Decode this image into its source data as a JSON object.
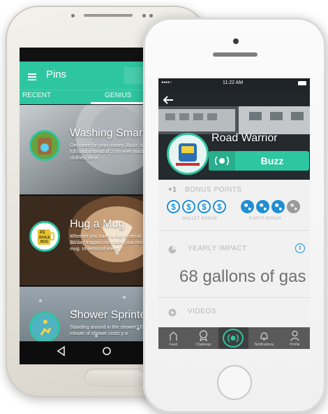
{
  "android": {
    "header_title": "Pins",
    "tabs": [
      "RECENT",
      "GENIUS"
    ],
    "cards": [
      {
        "title": "Washing Smart",
        "desc": "Get more for your money. Buzz. wash 1 full load instead of 2 sm ever wash clean clothes, be a"
      },
      {
        "title": "Hug a Mug",
        "desc": "Whether you have a cup o' decaf an $8/day frappuccino habit, you reusable mug. In terms of energ",
        "badge_top": "#1",
        "badge_mid": "JOULE",
        "badge_bottom": "BUG"
      },
      {
        "title": "Shower Sprinter",
        "desc": "Standing around in the shower? Every minute of shower costs y a"
      }
    ],
    "nav_icons": [
      "back-triangle",
      "home-circle"
    ]
  },
  "iphone": {
    "status": {
      "signal": "●●●●○",
      "time": "11:22 AM",
      "battery": "battery"
    },
    "title": "Road Warrior",
    "buzz_label": "Buzz",
    "bonus": {
      "prefix": "+1",
      "label": "BONUS POINTS",
      "wallet_label": "WALLET BONUS",
      "earth_label": "EARTH BONUS",
      "dollar_sign": "$"
    },
    "impact": {
      "label": "YEARLY IMPACT",
      "value": "68 gallons of gas",
      "info": "i"
    },
    "videos_label": "VIDEOS",
    "tabbar": [
      "Feed",
      "Challenge",
      "",
      "Notifications",
      "Profile"
    ],
    "colors": {
      "accent": "#2ec6a1",
      "coin_blue": "#1f8fd2"
    }
  }
}
